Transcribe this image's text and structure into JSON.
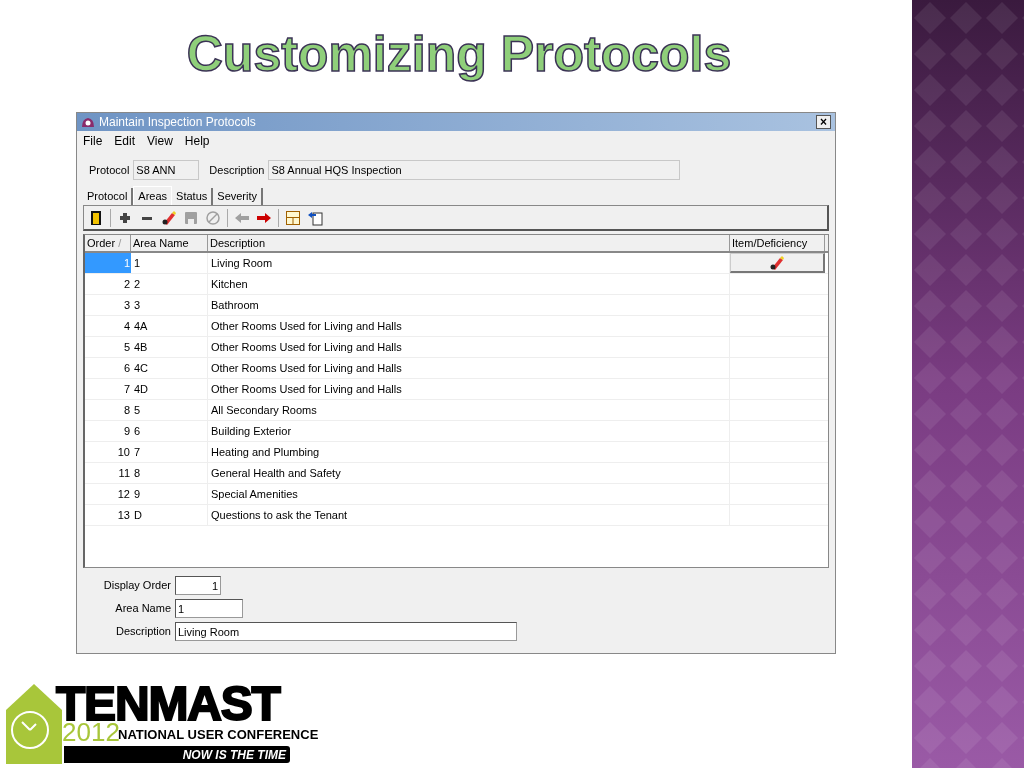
{
  "slide_title": "Customizing Protocols",
  "window": {
    "title": "Maintain Inspection Protocols",
    "close": "×"
  },
  "menu": [
    "File",
    "Edit",
    "View",
    "Help"
  ],
  "header_fields": [
    {
      "label": "Protocol",
      "value": "S8 ANN"
    },
    {
      "label": "Description",
      "value": "S8 Annual HQS Inspection"
    }
  ],
  "tabs": [
    {
      "label": "Protocol",
      "selected": false
    },
    {
      "label": "Areas",
      "selected": true
    },
    {
      "label": "Status",
      "selected": false
    },
    {
      "label": "Severity",
      "selected": false
    }
  ],
  "toolbar": [
    {
      "kind": "exit",
      "disabled": false
    },
    {
      "kind": "sep"
    },
    {
      "kind": "add",
      "disabled": false
    },
    {
      "kind": "remove",
      "disabled": false
    },
    {
      "kind": "edit",
      "disabled": false
    },
    {
      "kind": "save",
      "disabled": true
    },
    {
      "kind": "cancel",
      "disabled": true
    },
    {
      "kind": "sep"
    },
    {
      "kind": "prev",
      "disabled": true
    },
    {
      "kind": "next",
      "disabled": false
    },
    {
      "kind": "sep"
    },
    {
      "kind": "layout",
      "disabled": false
    },
    {
      "kind": "import",
      "disabled": false
    }
  ],
  "grid": {
    "columns": [
      "Order",
      "Area Name",
      "Description",
      "Item/Deficiency"
    ],
    "sort_mark": "/",
    "rows": [
      {
        "order": "1",
        "area_name": "1",
        "description": "Living Room",
        "selected": true
      },
      {
        "order": "2",
        "area_name": "2",
        "description": "Kitchen",
        "selected": false
      },
      {
        "order": "3",
        "area_name": "3",
        "description": "Bathroom",
        "selected": false
      },
      {
        "order": "4",
        "area_name": "4A",
        "description": "Other Rooms Used for Living and Halls",
        "selected": false
      },
      {
        "order": "5",
        "area_name": "4B",
        "description": "Other Rooms Used for Living and Halls",
        "selected": false
      },
      {
        "order": "6",
        "area_name": "4C",
        "description": "Other Rooms Used for Living and Halls",
        "selected": false
      },
      {
        "order": "7",
        "area_name": "4D",
        "description": "Other Rooms Used for Living and Halls",
        "selected": false
      },
      {
        "order": "8",
        "area_name": "5",
        "description": "All Secondary Rooms",
        "selected": false
      },
      {
        "order": "9",
        "area_name": "6",
        "description": "Building Exterior",
        "selected": false
      },
      {
        "order": "10",
        "area_name": "7",
        "description": "Heating and Plumbing",
        "selected": false
      },
      {
        "order": "11",
        "area_name": "8",
        "description": "General Health and Safety",
        "selected": false
      },
      {
        "order": "12",
        "area_name": "9",
        "description": "Special Amenities",
        "selected": false
      },
      {
        "order": "13",
        "area_name": "D",
        "description": "Questions to ask the Tenant",
        "selected": false
      }
    ]
  },
  "form": [
    {
      "label": "Display Order",
      "value": "1"
    },
    {
      "label": "Area Name",
      "value": "1"
    },
    {
      "label": "Description",
      "value": "Living Room"
    }
  ],
  "logo": {
    "name": "TENMAST",
    "year": "2012",
    "subtitle": "NATIONAL USER CONFERENCE",
    "tagline": "NOW IS THE TIME"
  }
}
